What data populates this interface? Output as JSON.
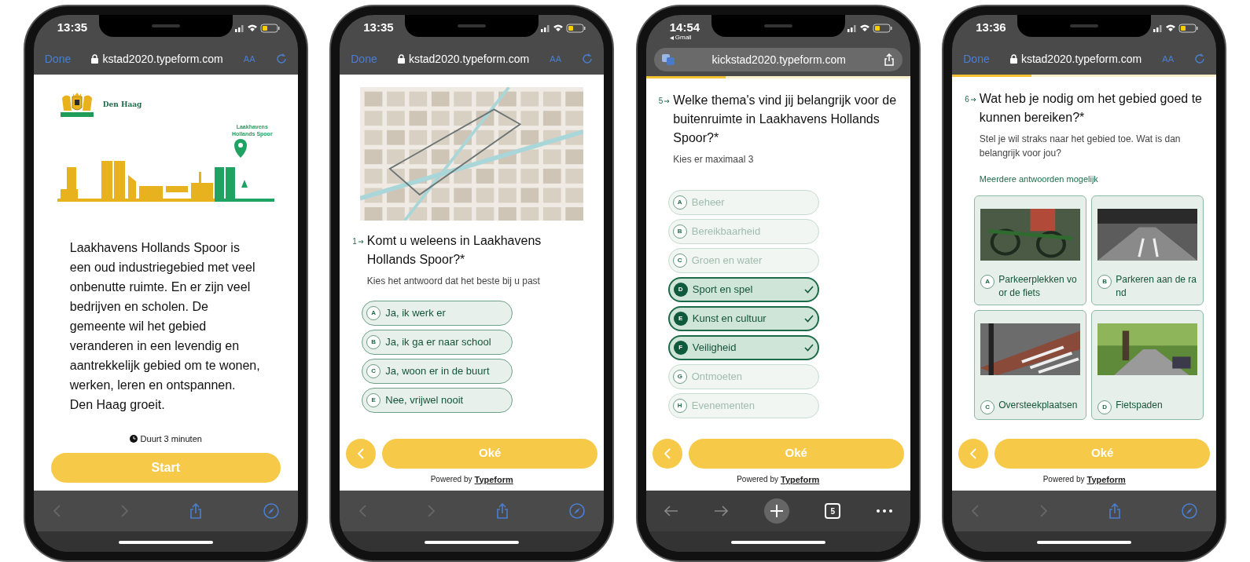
{
  "phones": [
    {
      "status": {
        "time": "13:35"
      },
      "browser": {
        "kind": "safari",
        "done": "Done",
        "url": "kstad2020.typeform.com",
        "text_size": "AA"
      },
      "screen": {
        "kind": "welcome",
        "logo_text": "Den Haag",
        "skyline_label": "Laakhavens Hollands Spoor",
        "paragraph": "Laakhavens Hollands Spoor is een oud industriegebied met veel onbenutte ruimte. En er zijn veel bedrijven en scholen. De gemeente wil het gebied veranderen in een levendig en aantrekkelijk gebied om te wonen, werken, leren en ontspannen. Den Haag groeit.",
        "duration": "Duurt 3 minuten",
        "start": "Start"
      }
    },
    {
      "status": {
        "time": "13:35"
      },
      "browser": {
        "kind": "safari",
        "done": "Done",
        "url": "kstad2020.typeform.com",
        "text_size": "AA"
      },
      "screen": {
        "kind": "question",
        "number": "1",
        "question": "Komt u weleens in Laakhavens Hollands Spoor?*",
        "hint": "Kies het antwoord dat het beste bij u past",
        "options": [
          {
            "kind": "pill",
            "letter": "A",
            "label": "Ja, ik werk er",
            "selected": false,
            "disabled": false
          },
          {
            "kind": "pill",
            "letter": "B",
            "label": "Ja, ik ga er naar school",
            "selected": false,
            "disabled": false
          },
          {
            "kind": "pill",
            "letter": "C",
            "label": "Ja, woon er in de buurt",
            "selected": false,
            "disabled": false
          },
          {
            "kind": "pill",
            "letter": "E",
            "label": "Nee, vrijwel nooit",
            "selected": false,
            "disabled": false
          }
        ],
        "ok": "Oké",
        "powered_by": "Powered by",
        "brand": "Typeform"
      }
    },
    {
      "status": {
        "time": "14:54",
        "back_app": "Gmail"
      },
      "browser": {
        "kind": "chrome",
        "url": "kickstad2020.typeform.com",
        "tabs": "5"
      },
      "screen": {
        "kind": "question",
        "progress": {
          "level": 0.3
        },
        "number": "5",
        "question": "Welke thema's vind jij belangrijk voor de buitenruimte in Laakhavens Hollands Spoor?*",
        "hint": "Kies er maximaal 3",
        "options": [
          {
            "kind": "pill",
            "letter": "A",
            "label": "Beheer",
            "selected": false,
            "disabled": true
          },
          {
            "kind": "pill",
            "letter": "B",
            "label": "Bereikbaarheid",
            "selected": false,
            "disabled": true
          },
          {
            "kind": "pill",
            "letter": "C",
            "label": "Groen en water",
            "selected": false,
            "disabled": true
          },
          {
            "kind": "pill",
            "letter": "D",
            "label": "Sport en spel",
            "selected": true,
            "disabled": false
          },
          {
            "kind": "pill",
            "letter": "E",
            "label": "Kunst en cultuur",
            "selected": true,
            "disabled": false
          },
          {
            "kind": "pill",
            "letter": "F",
            "label": "Veiligheid",
            "selected": true,
            "disabled": false
          },
          {
            "kind": "pill",
            "letter": "G",
            "label": "Ontmoeten",
            "selected": false,
            "disabled": true
          },
          {
            "kind": "pill",
            "letter": "H",
            "label": "Evenementen",
            "selected": false,
            "disabled": true
          }
        ],
        "ok": "Oké",
        "powered_by": "Powered by",
        "brand": "Typeform"
      }
    },
    {
      "status": {
        "time": "13:36"
      },
      "browser": {
        "kind": "safari",
        "done": "Done",
        "url": "kstad2020.typeform.com",
        "text_size": "AA"
      },
      "screen": {
        "kind": "question",
        "progress": {
          "level": 0.3
        },
        "number": "6",
        "question": "Wat heb je nodig om het gebied goed te kunnen bereiken?*",
        "hint": "Stel je wil straks naar het gebied toe. Wat is dan belangrijk voor jou?",
        "note": "Meerdere antwoorden mogelijk",
        "options": [
          {
            "kind": "card",
            "letter": "A",
            "label": "Parkeerplekken voor de fiets",
            "selected": false
          },
          {
            "kind": "card",
            "letter": "B",
            "label": "Parkeren aan de rand",
            "selected": false
          },
          {
            "kind": "card",
            "letter": "C",
            "label": "Oversteekplaatsen",
            "selected": false
          },
          {
            "kind": "card",
            "letter": "D",
            "label": "Fietspaden",
            "selected": false
          }
        ],
        "ok": "Oké",
        "powered_by": "Powered by",
        "brand": "Typeform"
      }
    }
  ]
}
